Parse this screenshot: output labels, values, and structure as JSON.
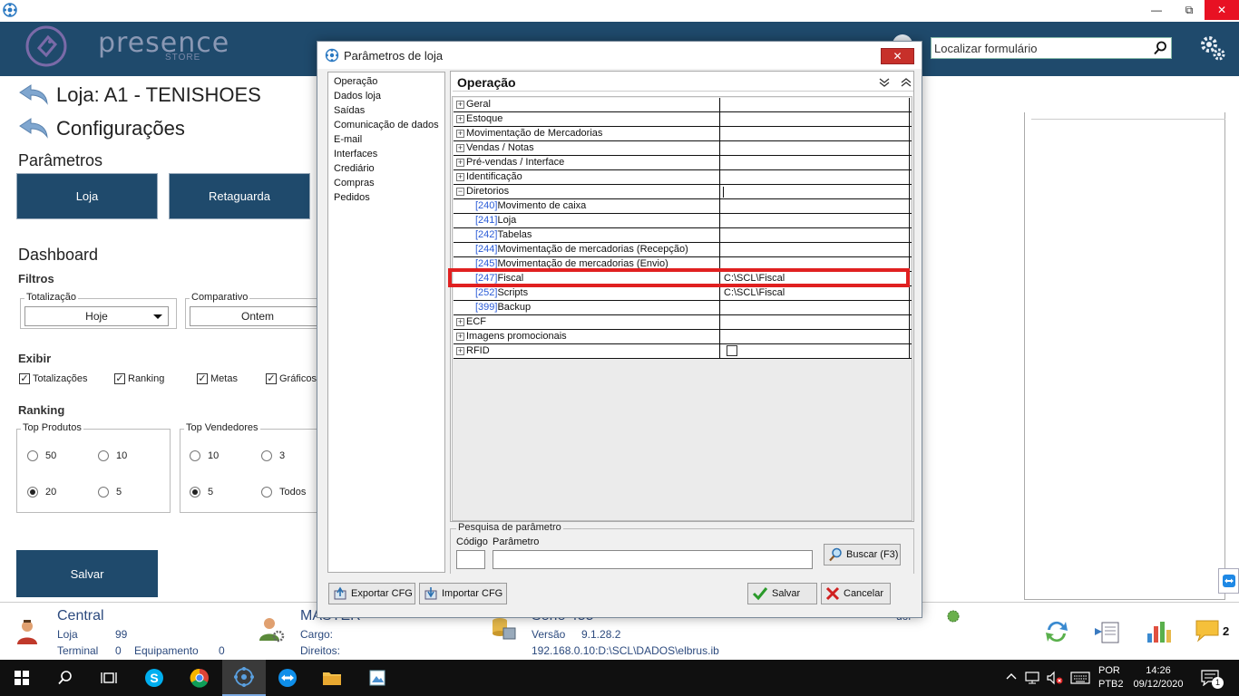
{
  "header": {
    "logo_text": "presence",
    "logo_sub": "STORE",
    "search_placeholder": "Localizar formulário"
  },
  "left": {
    "loja_title": "Loja: A1 - TENISHOES",
    "config_title": "Configurações",
    "parametros": "Parâmetros",
    "btn_loja": "Loja",
    "btn_retaguarda": "Retaguarda",
    "dashboard": "Dashboard",
    "filtros": "Filtros",
    "totalizacao_legend": "Totalização",
    "totalizacao_value": "Hoje",
    "comparativo_legend": "Comparativo",
    "comparativo_value": "Ontem",
    "exibir": "Exibir",
    "checkboxes": [
      "Totalizações",
      "Ranking",
      "Metas",
      "Gráficos"
    ],
    "ranking": "Ranking",
    "top_produtos": "Top Produtos",
    "top_vendedores": "Top Vendedores",
    "produtos_opts": [
      "50",
      "10",
      "20",
      "5"
    ],
    "vendedores_opts": [
      "10",
      "3",
      "5",
      "Todos"
    ],
    "salvar": "Salvar"
  },
  "status": {
    "central": "Central",
    "loja_label": "Loja",
    "loja_value": "99",
    "terminal_label": "Terminal",
    "terminal_value": "0",
    "equip_label": "Equipamento",
    "equip_value": "0",
    "user": "MASTER",
    "cargo": "Cargo:",
    "direitos": "Direitos:",
    "serie": "Série 455",
    "versao_label": "Versão",
    "versao_value": "9.1.28.2",
    "path": "192.168.0.10:D:\\SCL\\DADOS\\elbrus.ib",
    "extra": "dor",
    "badge": "2"
  },
  "taskbar": {
    "lang1": "POR",
    "lang2": "PTB2",
    "time": "14:26",
    "date": "09/12/2020",
    "notif": "1"
  },
  "dialog": {
    "title": "Parâmetros de loja",
    "menu": [
      "Operação",
      "Dados loja",
      "Saídas",
      "Comunicação de dados",
      "E-mail",
      "Interfaces",
      "Crediário",
      "Compras",
      "Pedidos"
    ],
    "grid_title": "Operação",
    "rows": [
      {
        "toggle": "+",
        "code": "",
        "label": "Geral",
        "value": ""
      },
      {
        "toggle": "+",
        "code": "",
        "label": "Estoque",
        "value": ""
      },
      {
        "toggle": "+",
        "code": "",
        "label": "Movimentação de Mercadorias",
        "value": ""
      },
      {
        "toggle": "+",
        "code": "",
        "label": "Vendas / Notas",
        "value": ""
      },
      {
        "toggle": "+",
        "code": "",
        "label": "Pré-vendas / Interface",
        "value": ""
      },
      {
        "toggle": "+",
        "code": "",
        "label": "Identificação",
        "value": ""
      },
      {
        "toggle": "−",
        "code": "",
        "label": "Diretorios",
        "value": ""
      },
      {
        "toggle": "",
        "code": "[240]",
        "label": "Movimento de caixa",
        "value": ""
      },
      {
        "toggle": "",
        "code": "[241]",
        "label": "Loja",
        "value": ""
      },
      {
        "toggle": "",
        "code": "[242]",
        "label": "Tabelas",
        "value": ""
      },
      {
        "toggle": "",
        "code": "[244]",
        "label": "Movimentação de mercadorias (Recepção)",
        "value": ""
      },
      {
        "toggle": "",
        "code": "[245]",
        "label": "Movimentação de mercadorias (Envio)",
        "value": ""
      },
      {
        "toggle": "",
        "code": "[247]",
        "label": "Fiscal",
        "value": "C:\\SCL\\Fiscal"
      },
      {
        "toggle": "",
        "code": "[252]",
        "label": "Scripts",
        "value": "C:\\SCL\\Fiscal"
      },
      {
        "toggle": "",
        "code": "[399]",
        "label": "Backup",
        "value": ""
      },
      {
        "toggle": "+",
        "code": "",
        "label": "ECF",
        "value": ""
      },
      {
        "toggle": "+",
        "code": "",
        "label": "Imagens promocionais",
        "value": ""
      },
      {
        "toggle": "+",
        "code": "",
        "label": "RFID",
        "value": ""
      }
    ],
    "pesquisa_legend": "Pesquisa de parâmetro",
    "codigo_label": "Código",
    "parametro_label": "Parâmetro",
    "buscar": "Buscar (F3)",
    "exportar": "Exportar CFG",
    "importar": "Importar CFG",
    "salvar": "Salvar",
    "cancelar": "Cancelar"
  },
  "colors": {
    "header_bg": "#1f4a6c",
    "highlight": "#e02020",
    "code_link": "#2a5bd7",
    "status_text": "#2c4a7e"
  }
}
